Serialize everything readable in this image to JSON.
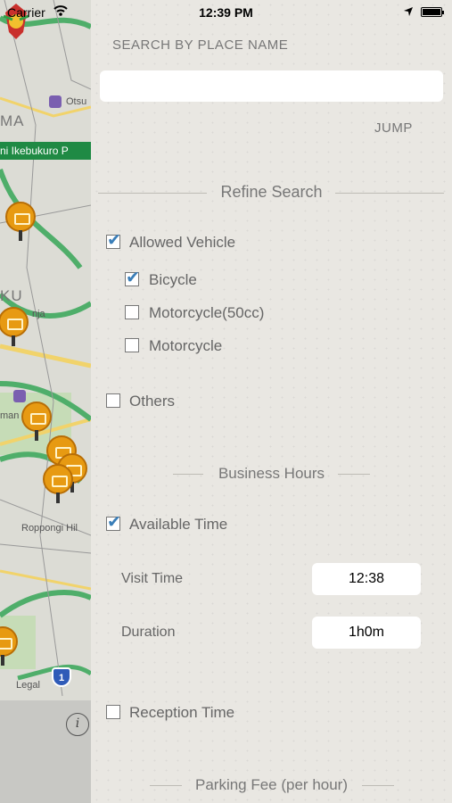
{
  "status_bar": {
    "carrier": "Carrier",
    "time": "12:39 PM"
  },
  "map": {
    "labels": {
      "otsu": "Otsu",
      "ma": "MA",
      "ku": "KU",
      "nja": "nja",
      "roppongi": "Roppongi Hil",
      "legal": "Legal",
      "man": "man"
    },
    "station_badge": "ni Ikebukuro P",
    "route_number": "1",
    "info_glyph": "i",
    "accent_green": "#1f8a44",
    "pin_color": "#e79a12"
  },
  "search": {
    "caption": "SEARCH BY PLACE NAME",
    "value": "",
    "placeholder": "",
    "jump_label": "JUMP"
  },
  "refine": {
    "title": "Refine Search",
    "allowed_vehicle": {
      "label": "Allowed Vehicle",
      "checked": true
    },
    "vehicles": [
      {
        "label": "Bicycle",
        "checked": true
      },
      {
        "label": "Motorcycle(50cc)",
        "checked": false
      },
      {
        "label": "Motorcycle",
        "checked": false
      }
    ],
    "others": {
      "label": "Others",
      "checked": false
    }
  },
  "business_hours": {
    "title": "Business Hours",
    "available_time": {
      "label": "Available Time",
      "checked": true
    },
    "visit_time": {
      "label": "Visit Time",
      "value": "12:38"
    },
    "duration": {
      "label": "Duration",
      "value": "1h0m"
    }
  },
  "reception_time": {
    "label": "Reception Time",
    "checked": false
  },
  "parking_fee": {
    "title": "Parking Fee (per hour)"
  },
  "colors": {
    "check_accent": "#3a7eb8",
    "panel_bg": "#e9e7e2"
  }
}
